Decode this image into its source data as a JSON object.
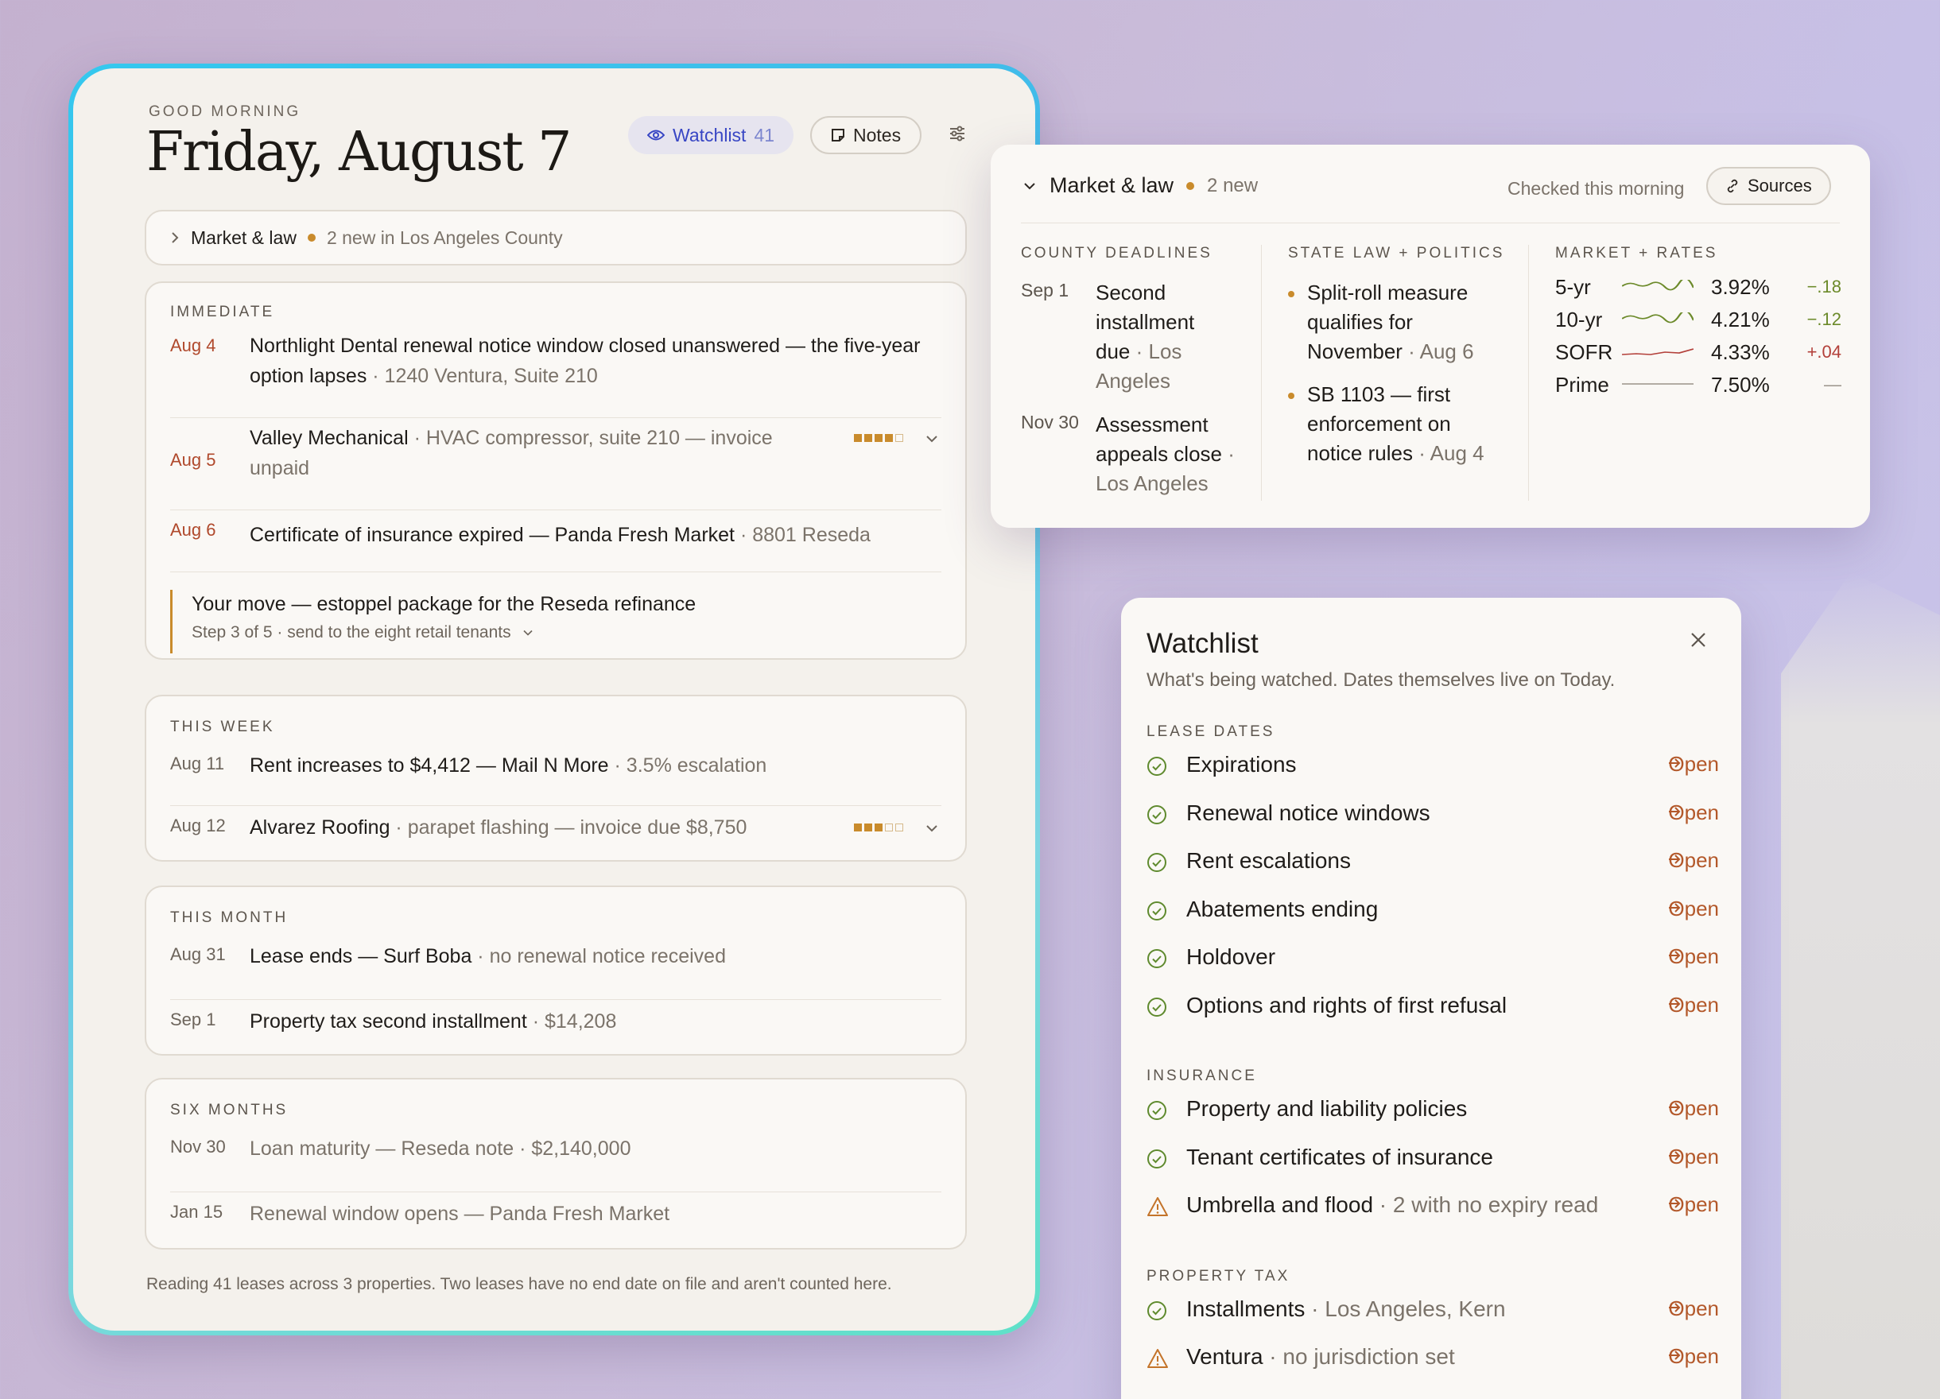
{
  "today": {
    "greeting": "GOOD MORNING",
    "date": "Friday, August 7",
    "watchlist_label": "Watchlist",
    "watchlist_count": "41",
    "notes_label": "Notes",
    "collapsed": {
      "title": "Market & law",
      "note": "2 new in Los Angeles County"
    },
    "immediate": {
      "label": "IMMEDIATE",
      "items": [
        {
          "date": "Aug 4",
          "text": "Northlight Dental renewal notice window closed unanswered — the five-year option lapses",
          "sub": " · 1240 Ventura, Suite 210"
        },
        {
          "date": "Aug 5",
          "text": "Valley Mechanical",
          "sub": " · HVAC compressor, suite 210 — invoice unpaid",
          "meter": 0.8
        },
        {
          "date": "Aug 6",
          "text": "Certificate of insurance expired — Panda Fresh Market",
          "sub": " · 8801 Reseda"
        }
      ],
      "move": {
        "text": "Your move — estoppel package for the Reseda refinance",
        "sub": "Step 3 of 5 · send to the eight retail tenants"
      }
    },
    "week": {
      "label": "THIS WEEK",
      "items": [
        {
          "date": "Aug 11",
          "text": "Rent increases to $4,412 — Mail N More",
          "sub": " · 3.5% escalation"
        },
        {
          "date": "Aug 12",
          "text": "Alvarez Roofing",
          "sub": " · parapet flashing — invoice due $8,750",
          "meter": 0.6
        }
      ]
    },
    "month": {
      "label": "THIS MONTH",
      "items": [
        {
          "date": "Aug 31",
          "text": "Lease ends — Surf Boba",
          "sub": " · no renewal notice received"
        },
        {
          "date": "Sep 1",
          "text": "Property tax second installment",
          "sub": " · $14,208"
        }
      ]
    },
    "six": {
      "label": "SIX MONTHS",
      "items": [
        {
          "date": "Nov 30",
          "text": "Loan maturity — Reseda note · $2,140,000"
        },
        {
          "date": "Jan 15",
          "text": "Renewal window opens — Panda Fresh Market"
        }
      ]
    },
    "footer": "Reading 41 leases across 3 properties. Two leases have no end date on file and aren't counted here."
  },
  "market": {
    "title": "Market & law",
    "new_count": "2 new",
    "checked": "Checked this morning",
    "sources_label": "Sources",
    "county": {
      "label": "COUNTY DEADLINES",
      "items": [
        {
          "date": "Sep 1",
          "lines": [
            "Second",
            "installment",
            "due"
          ],
          "sub1": " · Los",
          "sub2": "Angeles"
        },
        {
          "date": "Nov 30",
          "lines": [
            "Assessment",
            "appeals close"
          ],
          "sub1": " ·",
          "sub2": "Los Angeles"
        }
      ]
    },
    "state": {
      "label": "STATE LAW + POLITICS",
      "items": [
        {
          "lines": [
            "Split-roll measure",
            "qualifies for",
            "November"
          ],
          "sub": " · Aug 6"
        },
        {
          "lines": [
            "SB 1103 — first",
            "enforcement on",
            "notice rules"
          ],
          "sub": " · Aug 4"
        }
      ]
    },
    "rates": {
      "label": "MARKET + RATES",
      "items": [
        {
          "name": "5-yr",
          "value": "3.92%",
          "change": "−.18",
          "trend": "down",
          "color": "#6c8a2a"
        },
        {
          "name": "10-yr",
          "value": "4.21%",
          "change": "−.12",
          "trend": "down",
          "color": "#6c8a2a"
        },
        {
          "name": "SOFR",
          "value": "4.33%",
          "change": "+.04",
          "trend": "up",
          "color": "#b3403a"
        },
        {
          "name": "Prime",
          "value": "7.50%",
          "change": "—",
          "trend": "flat",
          "color": "#9a938a"
        }
      ]
    }
  },
  "watchlist": {
    "title": "Watchlist",
    "description": "What's being watched. Dates themselves live on Today.",
    "open_label": "Open",
    "sections": [
      {
        "label": "LEASE DATES",
        "items": [
          {
            "label": "Expirations",
            "status": "ok"
          },
          {
            "label": "Renewal notice windows",
            "status": "ok"
          },
          {
            "label": "Rent escalations",
            "status": "ok"
          },
          {
            "label": "Abatements ending",
            "status": "ok"
          },
          {
            "label": "Holdover",
            "status": "ok"
          },
          {
            "label": "Options and rights of first refusal",
            "status": "ok"
          }
        ]
      },
      {
        "label": "INSURANCE",
        "items": [
          {
            "label": "Property and liability policies",
            "status": "ok"
          },
          {
            "label": "Tenant certificates of insurance",
            "status": "ok"
          },
          {
            "label": "Umbrella and flood",
            "sub": " · 2 with no expiry read",
            "status": "warn"
          }
        ]
      },
      {
        "label": "PROPERTY TAX",
        "items": [
          {
            "label": "Installments",
            "sub": " · Los Angeles, Kern",
            "status": "ok"
          },
          {
            "label": "Ventura",
            "sub": " · no jurisdiction set",
            "status": "warn"
          }
        ]
      }
    ]
  },
  "colors": {
    "accent": "#c98b2c",
    "urgent": "#b0492c",
    "link": "#b3582a",
    "watch": "#3846c4"
  }
}
